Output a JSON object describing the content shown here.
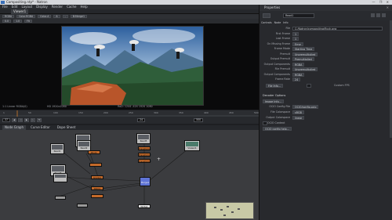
{
  "window": {
    "title": "Compositing.ntp* - Natron",
    "controls": "— ❐ ✕"
  },
  "menu": [
    "File",
    "Edit",
    "Layout",
    "Display",
    "Render",
    "Cache",
    "Help"
  ],
  "viewer": {
    "tab": "Viewer1",
    "toolbar": {
      "channels": "Color.RGBA",
      "alpha": "Color.A",
      "a_input": "A",
      "b_input": "B:Merge1"
    },
    "info_left": "1:1 Linear RGBA(0)",
    "info_res": "HD 1920x1080",
    "info_right": "RoD: 1244 -424 1920 1080"
  },
  "timeline": {
    "ticks": [
      "1",
      "50",
      "100",
      "150",
      "200",
      "250",
      "300",
      "350",
      "400",
      "450",
      "500"
    ],
    "current_frame": "37",
    "fps": "24",
    "end_frame": "500"
  },
  "node_graph": {
    "tabs": [
      "Node Graph",
      "Curve Editor",
      "Dope Sheet"
    ],
    "nodes": {
      "reader_top": "Read4",
      "reader_left1": "Read1",
      "reader_mid": "Read2",
      "reader_left2": "Read3",
      "reader_right_top": "Read5",
      "reader_right": "Viewer1",
      "merge": "Merge1",
      "transform1": "Transform1",
      "transform2": "Transform2",
      "transform3": "Transform3",
      "blur": "Blur1",
      "grade": "Grade1",
      "write": "Write1",
      "roto": "Roto1"
    }
  },
  "properties": {
    "title": "Properties",
    "node_name": "Read1",
    "tabs": [
      "Controls",
      "Node",
      "Info"
    ],
    "rows": [
      {
        "label": "File",
        "value": "C:/Natron/compositing/flush.png"
      },
      {
        "label": "First Frame",
        "value": "1"
      },
      {
        "label": "Last Frame",
        "value": "1"
      },
      {
        "label": "On Missing Frame",
        "value": "Error"
      },
      {
        "label": "Frame Mode",
        "value": "Starting Time"
      },
      {
        "label": "Premult",
        "value": "Unpremultiplied"
      },
      {
        "label": "Output Premult",
        "value": "Premultiplied"
      },
      {
        "label": "Output Components",
        "value": "RGBA"
      },
      {
        "label": "File Premult",
        "value": "Unpremultiplied"
      },
      {
        "label": "Output Components",
        "value": "RGBA"
      },
      {
        "label": "Frame Rate",
        "value": "24"
      }
    ],
    "file_info_btn": "File Info...",
    "custom_fps": "Custom FPS",
    "decoder_title": "Decoder Options",
    "decoder_btn": "Image Info...",
    "decoder_rows": [
      {
        "label": "OCIO Config File",
        "value": "OCIO/config.ocio"
      },
      {
        "label": "File Colorspace",
        "value": "sRGB"
      },
      {
        "label": "Output Colorspace",
        "value": "linear"
      }
    ],
    "ocio_context": "OCIO Context",
    "ocio_btn": "OCIO config help..."
  }
}
